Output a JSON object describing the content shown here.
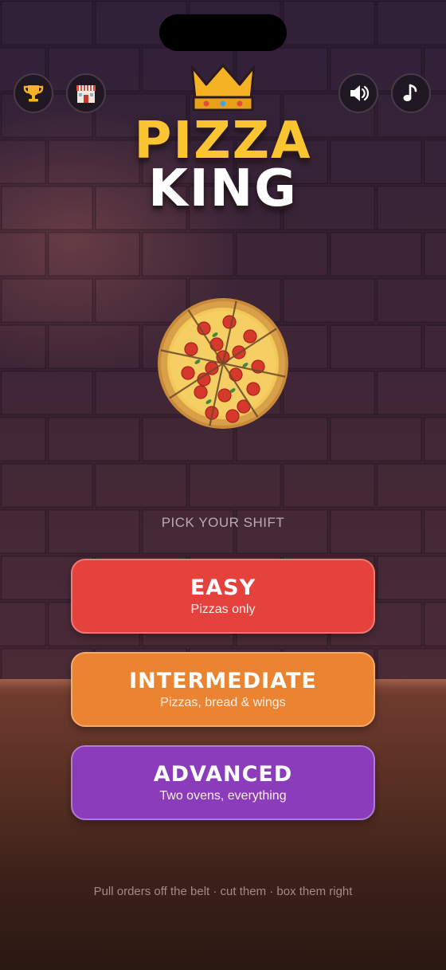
{
  "title": {
    "line1": "PIZZA",
    "line2": "KING"
  },
  "top_buttons": {
    "trophy": "trophy-icon",
    "shop": "shop-icon",
    "sound": "speaker-icon",
    "music": "music-note-icon"
  },
  "prompt": "PICK YOUR SHIFT",
  "modes": [
    {
      "title": "EASY",
      "subtitle": "Pizzas only",
      "color": "#e5413d"
    },
    {
      "title": "INTERMEDIATE",
      "subtitle": "Pizzas, bread & wings",
      "color": "#ea8431"
    },
    {
      "title": "ADVANCED",
      "subtitle": "Two ovens, everything",
      "color": "#8a3cba"
    }
  ],
  "footer": "Pull orders off the belt · cut them · box them right",
  "colors": {
    "accent_gold": "#fbc531",
    "wall": "#3d2536",
    "counter": "#6e3a2e"
  }
}
